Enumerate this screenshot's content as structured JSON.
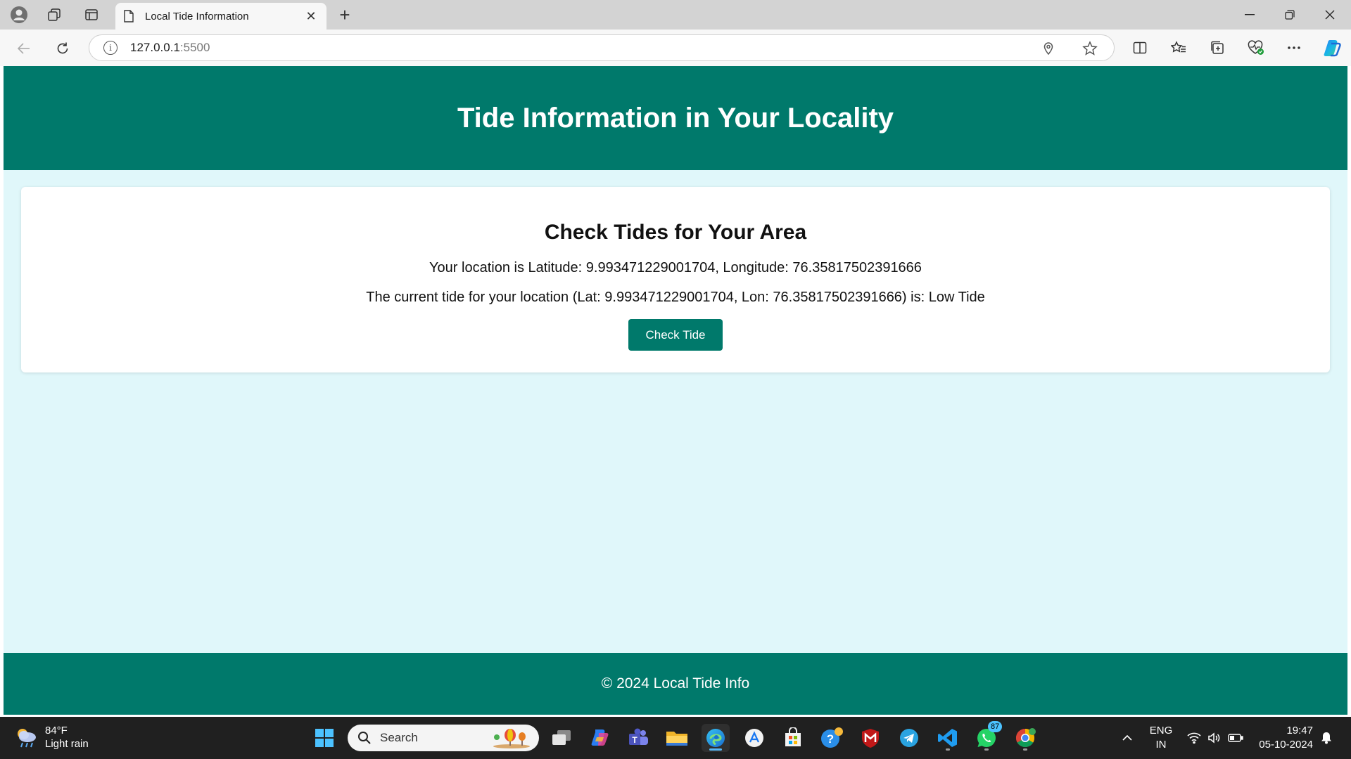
{
  "browser": {
    "tab_title": "Local Tide Information",
    "url_host": "127.0.0.1",
    "url_port": ":5500"
  },
  "page": {
    "header_title": "Tide Information in Your Locality",
    "card_title": "Check Tides for Your Area",
    "location_text": "Your location is Latitude: 9.993471229001704, Longitude: 76.35817502391666",
    "tide_text": "The current tide for your location (Lat: 9.993471229001704, Lon: 76.35817502391666) is: Low Tide",
    "check_button": "Check Tide",
    "footer_text": "© 2024 Local Tide Info"
  },
  "taskbar": {
    "weather_temp": "84°F",
    "weather_desc": "Light rain",
    "search_label": "Search",
    "whatsapp_badge": "87",
    "lang_line1": "ENG",
    "lang_line2": "IN",
    "time": "19:47",
    "date": "05-10-2024"
  },
  "colors": {
    "primary": "#00796b",
    "page_bg": "#e0f7fa"
  }
}
